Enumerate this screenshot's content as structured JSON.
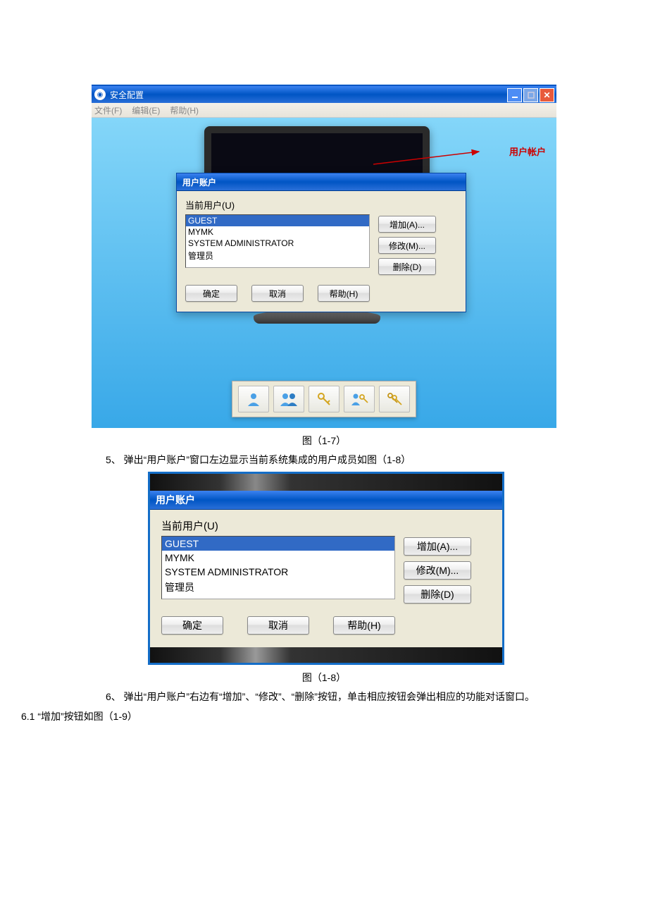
{
  "fig17": {
    "window_title": "安全配置",
    "menu": {
      "file": "文件(F)",
      "edit": "编辑(E)",
      "help": "帮助(H)"
    },
    "annotation": "用户帐户",
    "dialog": {
      "title": "用户账户",
      "current_user_label": "当前用户(U)",
      "users": [
        "GUEST",
        "MYMK",
        "SYSTEM ADMINISTRATOR",
        "管理员"
      ],
      "selected": "GUEST",
      "btn_add": "增加(A)...",
      "btn_modify": "修改(M)...",
      "btn_delete": "删除(D)",
      "btn_ok": "确定",
      "btn_cancel": "取消",
      "btn_help": "帮助(H)"
    },
    "dock_icons": [
      "user-icon",
      "users-icon",
      "key-icon",
      "user-key-icon",
      "keys-icon"
    ]
  },
  "caption17": "图（1-7）",
  "para5": "5、 弹出“用户账户”窗口左边显示当前系统集成的用户成员如图（1-8）",
  "fig18": {
    "dialog": {
      "title": "用户账户",
      "current_user_label": "当前用户(U)",
      "users": [
        "GUEST",
        "MYMK",
        "SYSTEM ADMINISTRATOR",
        "管理员"
      ],
      "selected": "GUEST",
      "btn_add": "增加(A)...",
      "btn_modify": "修改(M)...",
      "btn_delete": "删除(D)",
      "btn_ok": "确定",
      "btn_cancel": "取消",
      "btn_help": "帮助(H)"
    }
  },
  "caption18": "图（1-8）",
  "para6": "6、 弹出“用户账户”右边有“增加”、“修改”、“删除”按钮，单击相应按钮会弹出相应的功能对话窗口。",
  "para6_1": "6.1 “增加”按钮如图（1-9）"
}
